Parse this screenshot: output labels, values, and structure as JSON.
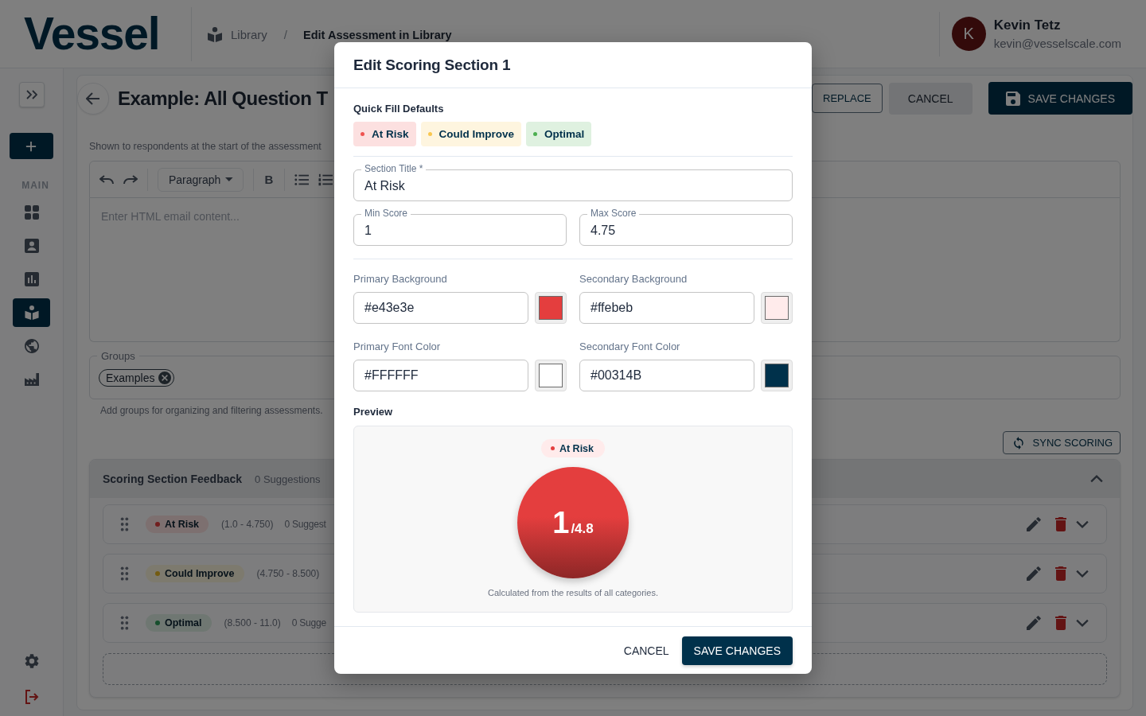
{
  "header": {
    "logo": "Vessel",
    "breadcrumb": [
      {
        "label": "Library",
        "current": false
      },
      {
        "label": "Edit Assessment in Library",
        "current": true
      }
    ],
    "separator": "/",
    "user": {
      "initial": "K",
      "name": "Kevin Tetz",
      "email": "kevin@vesselscale.com"
    }
  },
  "sidebar": {
    "section_label": "MAIN",
    "items": [
      {
        "selected": false
      },
      {
        "selected": false
      },
      {
        "selected": false
      },
      {
        "selected": true
      },
      {
        "selected": false
      },
      {
        "selected": false
      }
    ]
  },
  "page": {
    "title": "Example: All Question T",
    "actions": [
      {
        "label": "REPLACE",
        "kind": "outlined"
      },
      {
        "label": "CANCEL",
        "kind": "tonal"
      },
      {
        "label": "SAVE CHANGES",
        "kind": "primary"
      }
    ],
    "summary_hint": "Shown to respondents at the start of the assessment",
    "editor": {
      "block_format": "Paragraph",
      "bold": "B",
      "placeholder": "Enter HTML email content..."
    },
    "groups": {
      "label": "Groups",
      "chips": [
        "Examples"
      ],
      "hint": "Add groups for organizing and filtering assessments."
    },
    "sync_button": "SYNC SCORING",
    "feedback": {
      "title": "Scoring Section Feedback",
      "count": "0 Suggestions",
      "expanded": true,
      "sections": [
        {
          "name": "At Risk",
          "color": "#721f1f",
          "range": "(1.0 - 4.750)",
          "suggestions": "0 Suggest"
        },
        {
          "name": "Could Improve",
          "color": "#745c11",
          "range": "(4.750 - 8.500)"
        },
        {
          "name": "Optimal",
          "color": "#174f2d",
          "range": "(8.500 - 11.0)",
          "suggestions": "0 Sugge"
        }
      ]
    }
  },
  "modal": {
    "title": "Edit Scoring Section 1",
    "quick_fill": {
      "label": "Quick Fill Defaults",
      "presets": [
        {
          "label": "At Risk",
          "color": "#ef5350"
        },
        {
          "label": "Could Improve",
          "color": "#f9c74f"
        },
        {
          "label": "Optimal",
          "color": "#4caf50"
        }
      ]
    },
    "section_title": {
      "label": "Section Title *",
      "value": "At Risk"
    },
    "min_score": {
      "label": "Min Score",
      "value": "1"
    },
    "max_score": {
      "label": "Max Score",
      "value": "4.75"
    },
    "colors": [
      {
        "label": "Primary Background",
        "value": "#e43e3e"
      },
      {
        "label": "Secondary Background",
        "value": "#ffebeb"
      },
      {
        "label": "Primary Font Color",
        "value": "#FFFFFF"
      },
      {
        "label": "Secondary Font Color",
        "value": "#00314B"
      }
    ],
    "preview": {
      "label": "Preview",
      "badge": "At Risk",
      "score": "1",
      "score_max": "/4.8",
      "caption": "Calculated from the results of all categories."
    },
    "buttons": [
      {
        "label": "CANCEL",
        "kind": "text"
      },
      {
        "label": "SAVE CHANGES",
        "kind": "primary"
      }
    ]
  }
}
